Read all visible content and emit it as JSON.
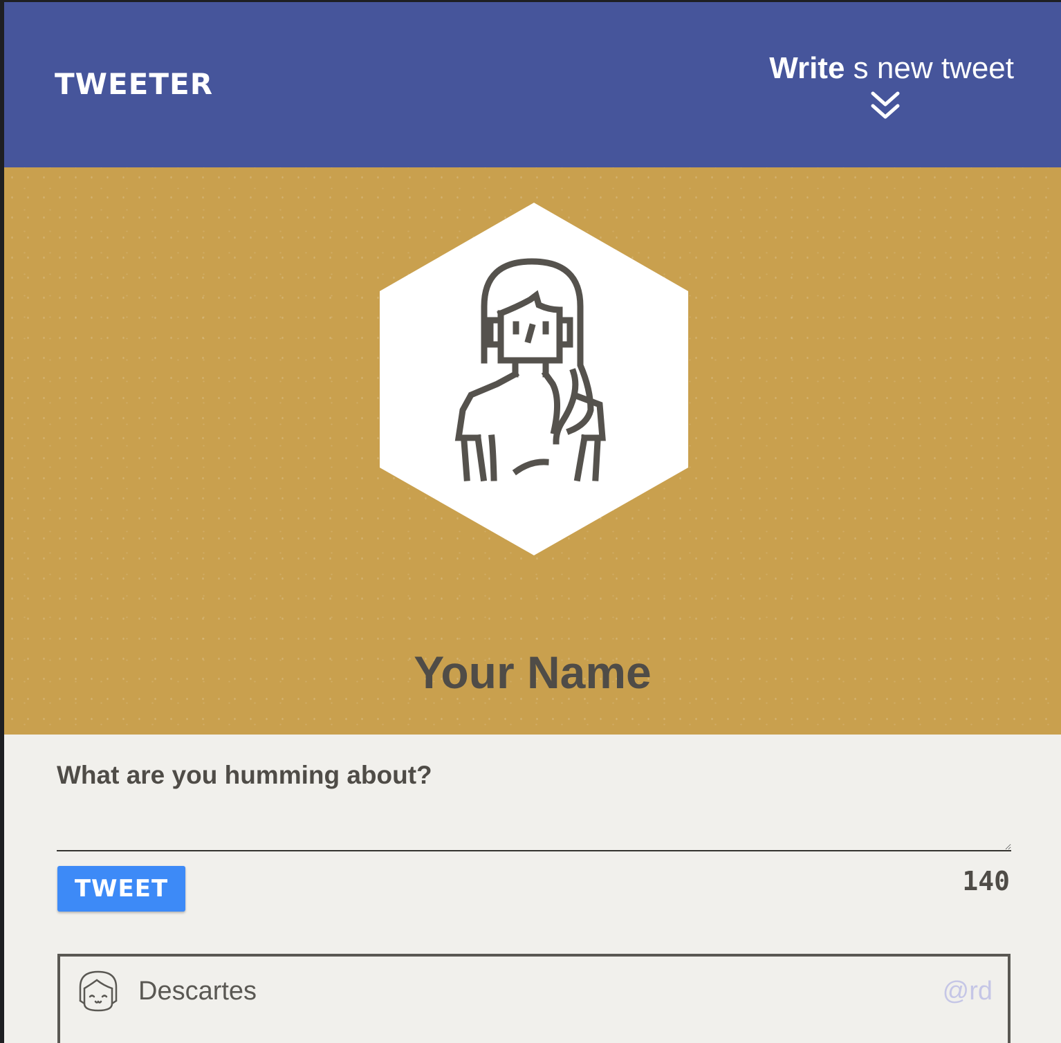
{
  "header": {
    "logo": "TWEETER",
    "compose_bold": "Write",
    "compose_rest": " s new tweet"
  },
  "profile": {
    "name": "Your Name"
  },
  "composer": {
    "prompt": "What are you humming about?",
    "text": "",
    "tweet_button": "TWEET",
    "char_count": "140"
  },
  "tweets": [
    {
      "author": "Descartes",
      "handle": "@rd"
    }
  ],
  "colors": {
    "nav_bg": "#46559b",
    "profile_bg": "#c9a04e",
    "body_bg": "#f1f0ec",
    "button_bg": "#3d8af7",
    "text": "#4f4c47",
    "handle": "#c5c6e6"
  },
  "icons": {
    "compose_toggle": "double-chevron-down-icon",
    "profile_avatar": "woman-avatar-icon",
    "tweet_avatar": "girl-face-icon"
  }
}
